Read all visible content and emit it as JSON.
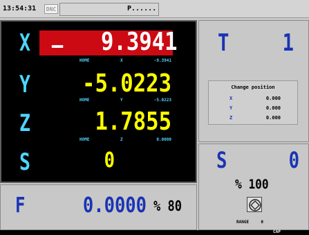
{
  "topbar": {
    "time": "13:54:31",
    "mode": "DNC",
    "program": "P......"
  },
  "axes": [
    {
      "letter": "X",
      "value": "9.3941",
      "sign": "–",
      "home_label": "HOME",
      "home_axis": "X",
      "home_value": "-9.3941",
      "color": "#ffffff"
    },
    {
      "letter": "Y",
      "value": "-5.0223",
      "home_label": "HOME",
      "home_axis": "Y",
      "home_value": "-5.0223",
      "color": "#ffff00"
    },
    {
      "letter": "Z",
      "value": "1.7855",
      "home_label": "HOME",
      "home_axis": "Z",
      "home_value": "0.0000",
      "color": "#ffff00"
    },
    {
      "letter": "S",
      "value": "0",
      "color": "#ffff00"
    }
  ],
  "tool": {
    "letter": "T",
    "number": "1"
  },
  "change_position": {
    "title": "Change position",
    "rows": [
      {
        "axis": "X",
        "value": "0.000"
      },
      {
        "axis": "Y",
        "value": "0.000"
      },
      {
        "axis": "Z",
        "value": "0.000"
      }
    ]
  },
  "spindle": {
    "letter": "S",
    "value": "0",
    "percent": "% 100",
    "range_label": "RANGE",
    "range_value": "0"
  },
  "feed": {
    "letter": "F",
    "value": "0.0000",
    "percent": "% 80"
  },
  "bottom": {
    "label": "CAP"
  },
  "colors": {
    "axis_letter": "#4dd6ff",
    "accent_blue": "#1a34b4",
    "x_highlight": "#cc0a14"
  }
}
